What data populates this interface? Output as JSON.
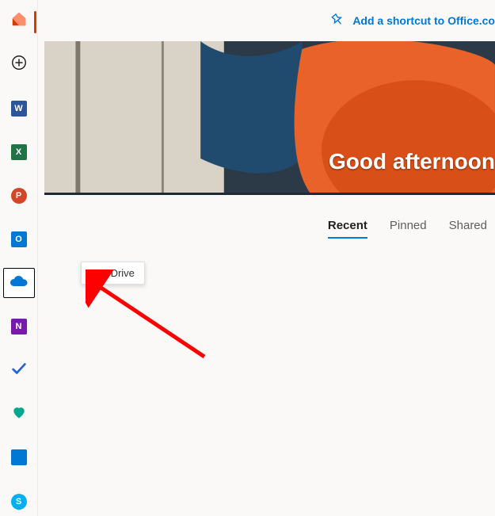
{
  "sidebar": {
    "items": [
      {
        "name": "home",
        "label": "Home"
      },
      {
        "name": "create",
        "label": "Create"
      },
      {
        "name": "word",
        "label": "Word"
      },
      {
        "name": "excel",
        "label": "Excel"
      },
      {
        "name": "powerpoint",
        "label": "PowerPoint"
      },
      {
        "name": "outlook",
        "label": "Outlook"
      },
      {
        "name": "onedrive",
        "label": "OneDrive"
      },
      {
        "name": "onenote",
        "label": "OneNote"
      },
      {
        "name": "todo",
        "label": "To Do"
      },
      {
        "name": "family",
        "label": "Family Safety"
      },
      {
        "name": "calendar",
        "label": "Calendar"
      },
      {
        "name": "skype",
        "label": "Skype"
      }
    ],
    "selected": "onedrive"
  },
  "topbar": {
    "shortcut_label": "Add a shortcut to Office.co"
  },
  "hero": {
    "greeting": "Good afternoon"
  },
  "tabs": {
    "items": [
      "Recent",
      "Pinned",
      "Shared"
    ],
    "active": "Recent"
  },
  "tooltip": {
    "text": "OneDrive"
  },
  "colors": {
    "link": "#0078d4",
    "word": "#2b579a",
    "excel": "#217346",
    "powerpoint": "#d24726",
    "outlook": "#0078d4",
    "onedrive": "#0078d4",
    "onenote": "#7719aa",
    "todo": "#2564cf",
    "family": "#00a88f",
    "calendar": "#0078d4",
    "skype": "#00aff0",
    "accent_orange": "#d83b01"
  }
}
